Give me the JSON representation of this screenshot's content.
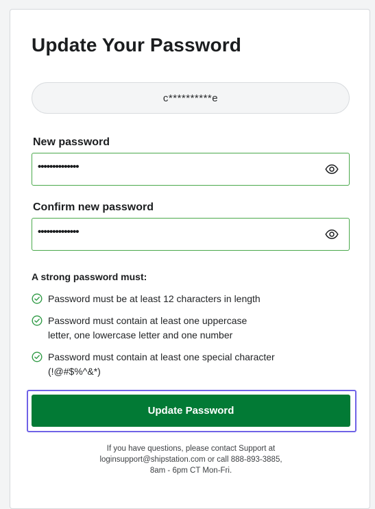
{
  "page": {
    "title": "Update Your Password",
    "username_masked": "c**********e"
  },
  "new_password": {
    "label": "New password",
    "value": "••••••••••••••",
    "toggle_icon": "eye-icon"
  },
  "confirm_password": {
    "label": "Confirm new password",
    "value": "••••••••••••••",
    "toggle_icon": "eye-icon"
  },
  "requirements": {
    "heading": "A strong password must:",
    "items": [
      {
        "text": "Password must be at least 12 characters in length",
        "met": true
      },
      {
        "text": "Password must contain at least one uppercase letter, one lowercase letter and one number",
        "met": true
      },
      {
        "text": "Password must contain at least one special character (!@#$%^&*)",
        "met": true
      }
    ]
  },
  "submit": {
    "label": "Update Password"
  },
  "footer": {
    "line1": "If you have questions, please contact Support at",
    "line2": "loginsupport@shipstation.com or call 888-893-3885,",
    "line3": "8am - 6pm CT Mon-Fri."
  },
  "colors": {
    "primary": "#027a35",
    "success": "#49a84a",
    "focus_ring": "#6f62e6"
  }
}
